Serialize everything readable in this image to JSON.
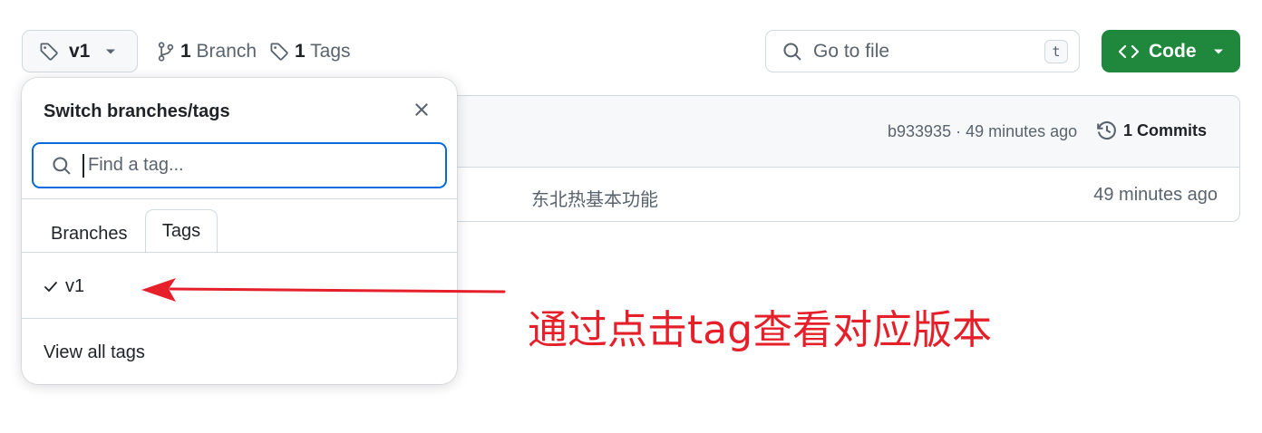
{
  "toolbar": {
    "current_ref": "v1",
    "branch_count": "1",
    "branch_label": "Branch",
    "tag_count": "1",
    "tag_label": "Tags",
    "go_to_file_placeholder": "Go to file",
    "go_to_file_shortcut": "t",
    "code_label": "Code"
  },
  "latest_commit": {
    "info": "b933935 · 49 minutes ago",
    "commits_count": "1",
    "commits_label": "Commits"
  },
  "file_row": {
    "message": "东北热基本功能",
    "time": "49 minutes ago"
  },
  "dropdown": {
    "title": "Switch branches/tags",
    "filter_placeholder": "Find a tag...",
    "tabs": [
      "Branches",
      "Tags"
    ],
    "active_tab": "Tags",
    "items": [
      {
        "label": "v1",
        "selected": true
      }
    ],
    "view_all_label": "View all tags"
  },
  "annotation": {
    "text": "通过点击tag查看对应版本",
    "color": "#e5202a"
  },
  "colors": {
    "accent_blue": "#0969da",
    "code_green": "#1f883d",
    "border": "#d1d9e0",
    "muted": "#59636e"
  },
  "icons": [
    "tag-icon",
    "chevron-down-icon",
    "git-branch-icon",
    "search-icon",
    "code-icon",
    "history-icon",
    "close-icon",
    "check-icon",
    "arrow-annotation"
  ]
}
